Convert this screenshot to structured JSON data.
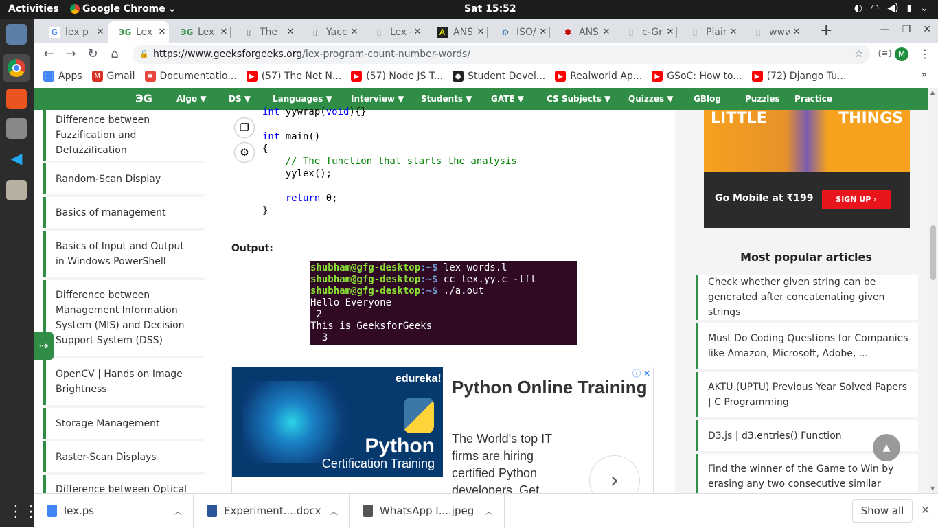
{
  "os": {
    "activities": "Activities",
    "app_name": "Google Chrome",
    "clock": "Sat 15:52"
  },
  "tabs": [
    {
      "label": "lex p",
      "icon": "google"
    },
    {
      "label": "Lex I",
      "icon": "gfg"
    },
    {
      "label": "Lex p",
      "icon": "gfg"
    },
    {
      "label": "The",
      "icon": "doc"
    },
    {
      "label": "Yacc",
      "icon": "doc"
    },
    {
      "label": "Lex -",
      "icon": "doc"
    },
    {
      "label": "ANS",
      "icon": "ans"
    },
    {
      "label": "ISO/",
      "icon": "iso"
    },
    {
      "label": "ANS",
      "icon": "ans-red"
    },
    {
      "label": "c-Gr",
      "icon": "doc"
    },
    {
      "label": "Plair",
      "icon": "doc"
    },
    {
      "label": "www",
      "icon": "doc"
    }
  ],
  "url": {
    "host": "https://www.geeksforgeeks.org",
    "path": "/lex-program-count-number-words/"
  },
  "profile_initial": "M",
  "bookmarks": [
    "Apps",
    "Gmail",
    "Documentatio...",
    "(57) The Net N...",
    "(57) Node JS T...",
    "Student Devel...",
    "Realworld Ap...",
    "GSoC: How to...",
    "(72) Django Tu..."
  ],
  "gfg_nav": {
    "logo": "ЭG",
    "items": [
      "Algo ▼",
      "DS ▼",
      "Languages ▼",
      "Interview ▼",
      "Students ▼",
      "GATE ▼",
      "CS Subjects ▼",
      "Quizzes ▼",
      "GBlog",
      "Puzzles",
      "Practice"
    ]
  },
  "left_articles": [
    "Difference between Fuzzification and Defuzzification",
    "Random-Scan Display",
    "Basics of management",
    "Basics of Input and Output in Windows PowerShell",
    "Difference between Management Information System (MIS) and Decision Support System (DSS)",
    "OpenCV | Hands on Image Brightness",
    "Storage Management",
    "Raster-Scan Displays",
    "Difference between Optical"
  ],
  "code": {
    "l1a": "int ",
    "l1b": "yywrap(",
    "l1c": "void",
    "l1d": "){}",
    "l2a": "int ",
    "l2b": "main()",
    "l3": "{",
    "l4": "    // The function that starts the analysis",
    "l5": "    yylex();",
    "l6a": "    return ",
    "l6b": "0;",
    "l7": "}"
  },
  "output_label": "Output:",
  "terminal": {
    "user": "shubham@gfg-desktop",
    "sep": ":~$",
    "cmd1": " lex words.l",
    "cmd2": " cc lex.yy.c -lfl",
    "cmd3": " ./a.out",
    "o1": "Hello Everyone",
    "o2": " 2",
    "o3": "This is GeeksforGeeks",
    "o4": "  3"
  },
  "ad": {
    "brand": "edureka!",
    "img_title": "Python",
    "img_sub": "Certification Training",
    "title": "Python Online Training",
    "text": "The World's top IT firms are hiring certified Python developers. Get"
  },
  "promo": {
    "top": "LITTLE",
    "top2": "THINGS",
    "text": "Go Mobile at ₹199",
    "cta": "SIGN UP"
  },
  "most_popular": {
    "heading": "Most popular articles",
    "items": [
      "Check whether given string can be generated after concatenating given strings",
      "Must Do Coding Questions for Companies like Amazon, Microsoft, Adobe, ...",
      "AKTU (UPTU) Previous Year Solved Papers | C Programming",
      "D3.js | d3.entries() Function",
      "Find the winner of the Game to Win by erasing any two consecutive similar"
    ]
  },
  "downloads": {
    "items": [
      "lex.ps",
      "Experiment....docx",
      "WhatsApp I....jpeg"
    ],
    "show_all": "Show all"
  }
}
